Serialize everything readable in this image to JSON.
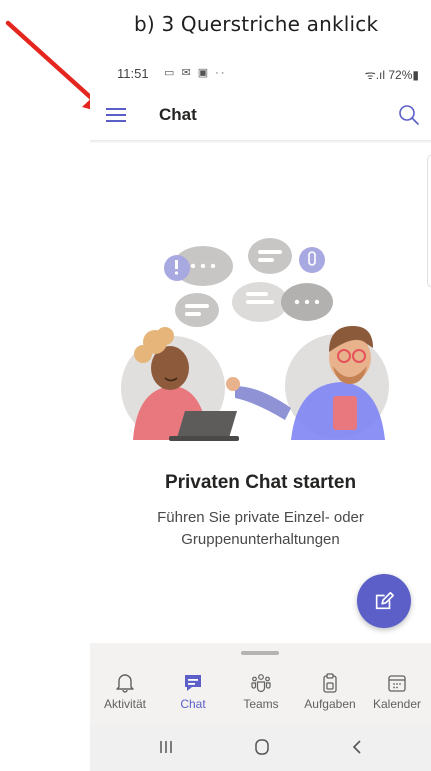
{
  "caption": "b)   3 Querstriche anklick",
  "status_bar": {
    "time": "11:51",
    "notification_icons": "▭ ✉ ▣ ··",
    "right": "ᯤ.ıl 72%▮"
  },
  "app_bar": {
    "title": "Chat",
    "menu_icon": "hamburger-menu-icon",
    "search_icon": "search-icon"
  },
  "empty_state": {
    "title": "Privaten Chat starten",
    "subtitle_line1": "Führen Sie private Einzel- oder",
    "subtitle_line2": "Gruppenunterhaltungen"
  },
  "fab": {
    "icon": "compose-icon"
  },
  "bottom_nav": {
    "items": [
      {
        "label": "Aktivität",
        "icon": "bell-icon",
        "active": false
      },
      {
        "label": "Chat",
        "icon": "chat-icon",
        "active": true
      },
      {
        "label": "Teams",
        "icon": "teams-icon",
        "active": false
      },
      {
        "label": "Aufgaben",
        "icon": "tasks-icon",
        "active": false
      },
      {
        "label": "Kalender",
        "icon": "calendar-icon",
        "active": false
      }
    ]
  },
  "colors": {
    "accent": "#5b5fc7",
    "annotation_arrow": "#e5261f",
    "nav_background": "#f3f2f1"
  }
}
